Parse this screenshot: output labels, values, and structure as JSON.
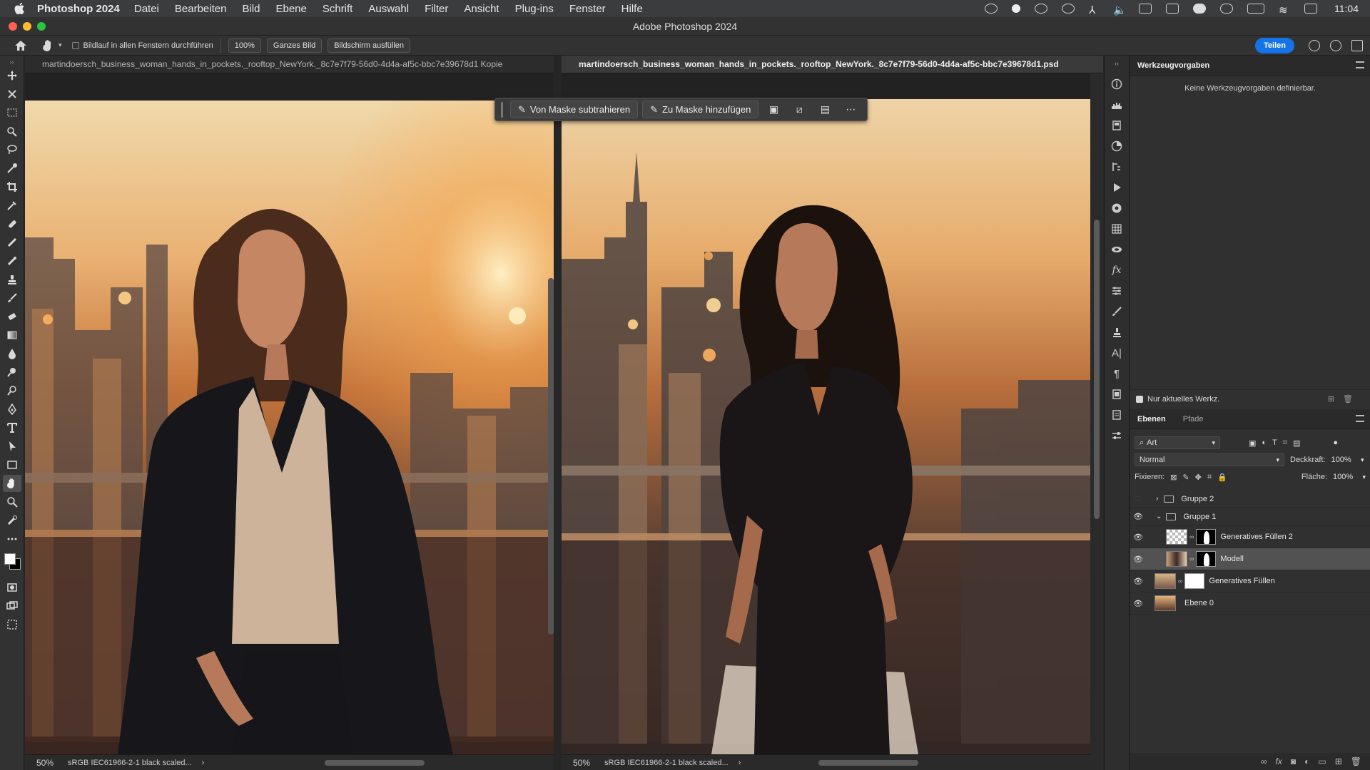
{
  "menubar": {
    "app_name": "Photoshop 2024",
    "items": [
      "Datei",
      "Bearbeiten",
      "Bild",
      "Ebene",
      "Schrift",
      "Auswahl",
      "Filter",
      "Ansicht",
      "Plug-ins",
      "Fenster",
      "Hilfe"
    ],
    "clock": "11:04"
  },
  "window": {
    "title": "Adobe Photoshop 2024"
  },
  "options_bar": {
    "scroll_all_label": "Bildlauf in allen Fenstern durchführen",
    "zoom_100": "100%",
    "fit_screen": "Ganzes Bild",
    "fill_screen": "Bildschirm ausfüllen",
    "share": "Teilen"
  },
  "documents": [
    {
      "tab": "martindoersch_business_woman_hands_in_pockets._rooftop_NewYork._8c7e7f79-56d0-4d4a-af5c-bbc7e39678d1 Kopie",
      "zoom": "50%",
      "profile": "sRGB IEC61966-2-1 black scaled..."
    },
    {
      "tab": "martindoersch_business_woman_hands_in_pockets._rooftop_NewYork._8c7e7f79-56d0-4d4a-af5c-bbc7e39678d1.psd",
      "zoom": "50%",
      "profile": "sRGB IEC61966-2-1 black scaled..."
    }
  ],
  "taskbar": {
    "subtract": "Von Maske subtrahieren",
    "add": "Zu Maske hinzufügen"
  },
  "presets_panel": {
    "tab": "Werkzeugvorgaben",
    "empty_text": "Keine Werkzeugvorgaben definierbar.",
    "current_tool_only": "Nur aktuelles Werkz."
  },
  "layers_panel": {
    "tab_layers": "Ebenen",
    "tab_paths": "Pfade",
    "filter_kind": "Art",
    "blend_mode": "Normal",
    "opacity_label": "Deckkraft:",
    "opacity_value": "100%",
    "lock_label": "Fixieren:",
    "fill_label": "Fläche:",
    "fill_value": "100%",
    "layers": [
      {
        "name": "Gruppe 2"
      },
      {
        "name": "Gruppe 1"
      },
      {
        "name": "Generatives Füllen 2"
      },
      {
        "name": "Modell"
      },
      {
        "name": "Generatives Füllen"
      },
      {
        "name": "Ebene 0"
      }
    ]
  },
  "colors": {
    "accent": "#1473e6",
    "panel_bg": "#303030",
    "selected_layer": "#525252"
  }
}
